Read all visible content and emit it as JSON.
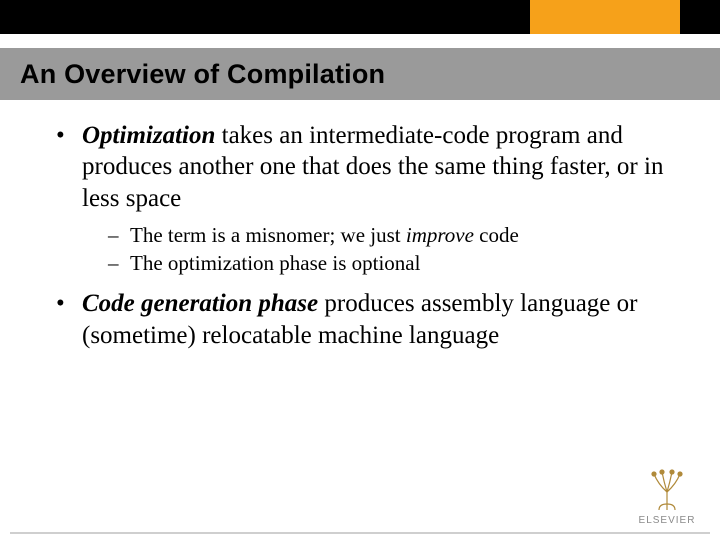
{
  "header": {
    "title": "An Overview of Compilation"
  },
  "body": {
    "bullets": [
      {
        "lead_italic": "Optimization",
        "rest": " takes an intermediate-code program and produces another one that does the same thing faster, or in less space",
        "sub": [
          {
            "prefix": "The term is a misnomer; we just ",
            "italic": "improve",
            "suffix": " code"
          },
          {
            "prefix": "The optimization phase is optional",
            "italic": "",
            "suffix": ""
          }
        ]
      },
      {
        "lead_italic": "Code generation phase",
        "rest": " produces assembly language or (sometime) relocatable machine language",
        "sub": []
      }
    ]
  },
  "footer": {
    "publisher": "ELSEVIER"
  }
}
